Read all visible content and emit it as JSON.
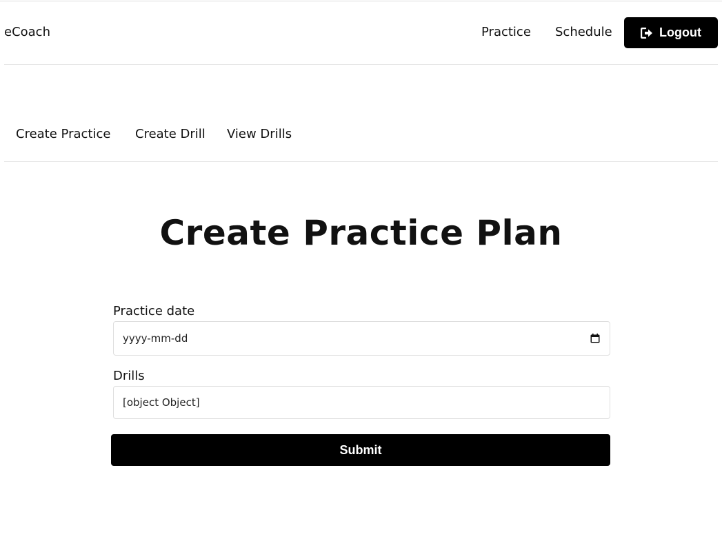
{
  "navbar": {
    "brand": "eCoach",
    "links": [
      "Practice",
      "Schedule"
    ],
    "logout": {
      "label": "Logout",
      "icon": "sign-out-icon"
    }
  },
  "subnav": {
    "links": [
      "Create Practice",
      "Create Drill",
      "View Drills"
    ]
  },
  "page": {
    "title": "Create Practice Plan"
  },
  "form": {
    "practice_date": {
      "label": "Practice date",
      "placeholder": "yyyy-mm-dd",
      "icon": "calendar-icon"
    },
    "drills": {
      "label": "Drills",
      "value": "[object Object]"
    },
    "submit_label": "Submit"
  },
  "colors": {
    "primary_button": "#000000",
    "button_text": "#ffffff",
    "text": "#111111",
    "border": "#dedede"
  }
}
